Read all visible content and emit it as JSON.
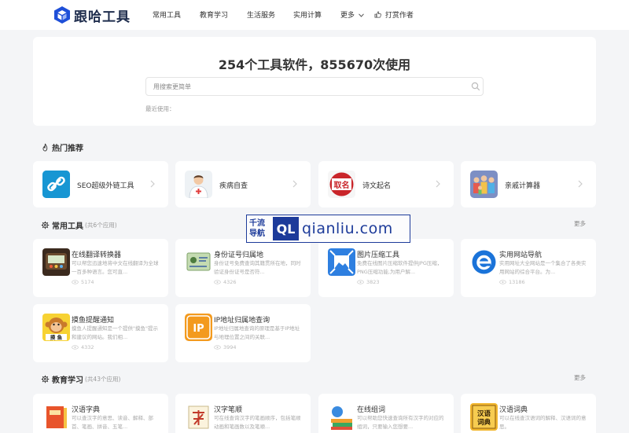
{
  "header": {
    "logo_text": "跟哈工具",
    "nav": [
      "常用工具",
      "教育学习",
      "生活服务",
      "实用计算",
      "更多",
      "打赏作者"
    ]
  },
  "hero": {
    "title": "254个工具软件，855670次使用",
    "search_placeholder": "用搜索更简单",
    "recent_label": "最近使用："
  },
  "hot": {
    "title": "热门推荐",
    "items": [
      "SEO超级外链工具",
      "疾病自查",
      "诗文起名",
      "亲戚计算器"
    ]
  },
  "common": {
    "title": "常用工具",
    "count": "(共6个应用)",
    "more": "更多",
    "items": [
      {
        "title": "在线翻译转换器",
        "desc": "可以帮您迅速地将中文在线翻译为全球一百多种语言。您可直...",
        "views": "5174"
      },
      {
        "title": "身份证号归属地",
        "desc": "身份证号免费查询其籍贯所在地，同时验证身份证号是否符...",
        "views": "4326"
      },
      {
        "title": "图片压缩工具",
        "desc": "免费在线图片压缩软件提供JPG压缩，PNG压缩功能,为用户解...",
        "views": "3823"
      },
      {
        "title": "实用网站导航",
        "desc": "实用网址大全网站是一个集合了各类实用网站的综合平台。为...",
        "views": "13186"
      },
      {
        "title": "摸鱼提醒通知",
        "desc": "摸鱼人提醒通知是一个提供\"摸鱼\"提示和建议的网站。我们相...",
        "views": "4332"
      },
      {
        "title": "IP地址归属地查询",
        "desc": "IP地址归属地查询的原理是基于IP地址与地理位置之间的关联...",
        "views": "3994"
      }
    ]
  },
  "education": {
    "title": "教育学习",
    "count": "(共43个应用)",
    "more": "更多",
    "items": [
      {
        "title": "汉语字典",
        "desc": "可以查汉字的意思、读音、解释、部首、笔画、拼音、五笔..."
      },
      {
        "title": "汉字笔顺",
        "desc": "可在线查询汉字的笔画顺序，包括笔顺动画和笔画数以及笔顺..."
      },
      {
        "title": "在线组词",
        "desc": "可以帮助您快速查询所有汉字的对应的组词，只要输入您想要..."
      },
      {
        "title": "汉语词典",
        "desc": "可以在线查汉语词的解释、汉语词的意思。"
      }
    ]
  },
  "watermark": {
    "zh_line1": "千流",
    "zh_line2": "导航",
    "badge": "QL",
    "url": "qianliu.com"
  },
  "icon_badges": {
    "moyu": "摸 鱼",
    "ip": "IP",
    "poem": "取名",
    "cidian": "汉语词典"
  }
}
